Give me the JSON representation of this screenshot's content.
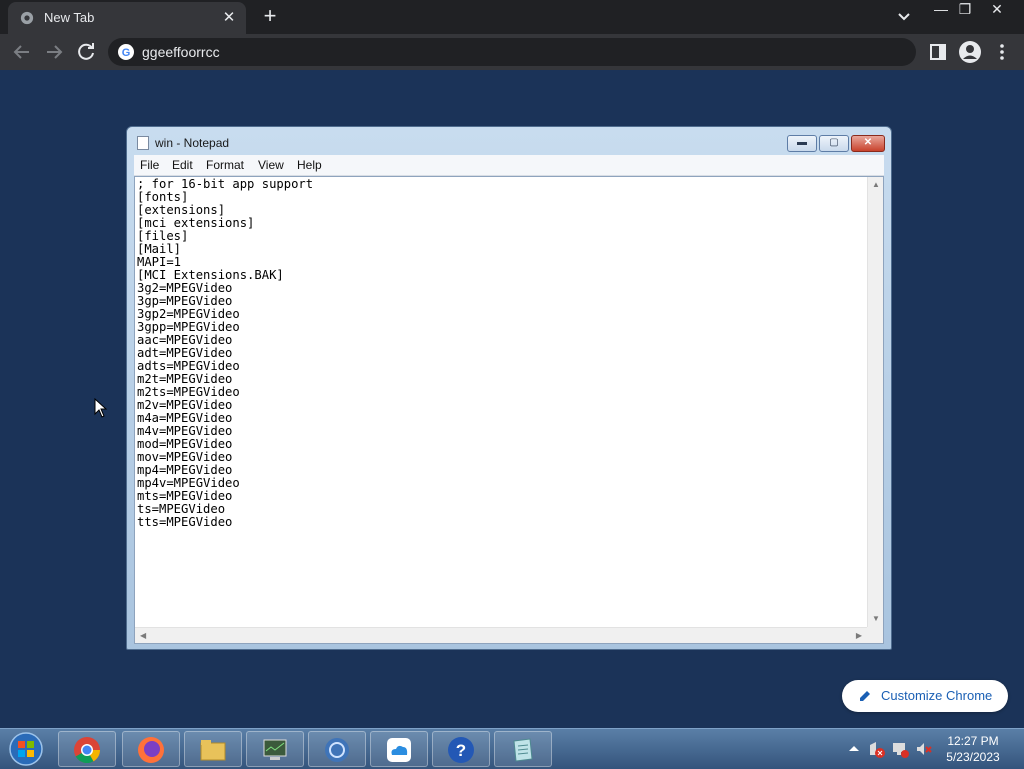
{
  "browser": {
    "tab_title": "New Tab",
    "tab_close": "✕",
    "new_tab": "+",
    "address": "ggeeffoorrcc",
    "minimize": "—",
    "restore": "❐",
    "close": "✕"
  },
  "notepad": {
    "title": "win - Notepad",
    "menu": [
      "File",
      "Edit",
      "Format",
      "View",
      "Help"
    ],
    "content": "; for 16-bit app support\n[fonts]\n[extensions]\n[mci extensions]\n[files]\n[Mail]\nMAPI=1\n[MCI Extensions.BAK]\n3g2=MPEGVideo\n3gp=MPEGVideo\n3gp2=MPEGVideo\n3gpp=MPEGVideo\naac=MPEGVideo\nadt=MPEGVideo\nadts=MPEGVideo\nm2t=MPEGVideo\nm2ts=MPEGVideo\nm2v=MPEGVideo\nm4a=MPEGVideo\nm4v=MPEGVideo\nmod=MPEGVideo\nmov=MPEGVideo\nmp4=MPEGVideo\nmp4v=MPEGVideo\nmts=MPEGVideo\nts=MPEGVideo\ntts=MPEGVideo"
  },
  "customize": {
    "label": "Customize Chrome"
  },
  "taskbar": {
    "time": "12:27 PM",
    "date": "5/23/2023",
    "icons": [
      "chrome-icon",
      "firefox-icon",
      "file-explorer-icon",
      "task-manager-icon",
      "network-setup-icon",
      "cloud-icon",
      "help-icon",
      "notepad-icon"
    ]
  },
  "colors": {
    "desktop": "#1b3358",
    "chrome_dark": "#202124",
    "chrome_toolbar": "#35363a",
    "accent_blue": "#1a5fb4"
  }
}
